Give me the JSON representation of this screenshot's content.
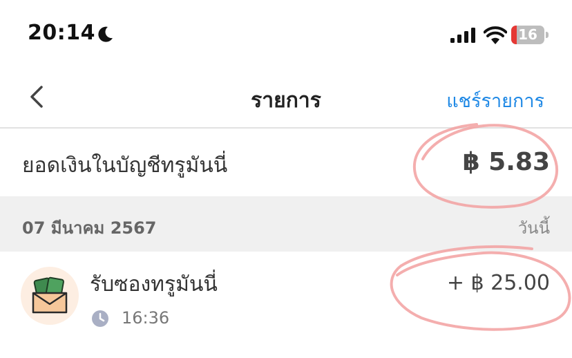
{
  "status_bar": {
    "time": "20:14",
    "battery_level": "16",
    "icons": [
      "moon-icon",
      "signal-icon",
      "wifi-icon",
      "battery-icon"
    ]
  },
  "nav": {
    "title": "รายการ",
    "share_label": "แชร์รายการ",
    "back_icon": "chevron-left-icon",
    "accent_color": "#1e88e5"
  },
  "balance": {
    "label": "ยอดเงินในบัญชีทรูมันนี่",
    "value": "฿ 5.83"
  },
  "date_group": {
    "date": "07 มีนาคม 2567",
    "relative": "วันนี้"
  },
  "transactions": [
    {
      "title": "รับซองทรูมันนี่",
      "time": "16:36",
      "amount": "+ ฿ 25.00",
      "icon": "money-envelope-icon"
    }
  ],
  "annotation_color": "#f2a0a0"
}
